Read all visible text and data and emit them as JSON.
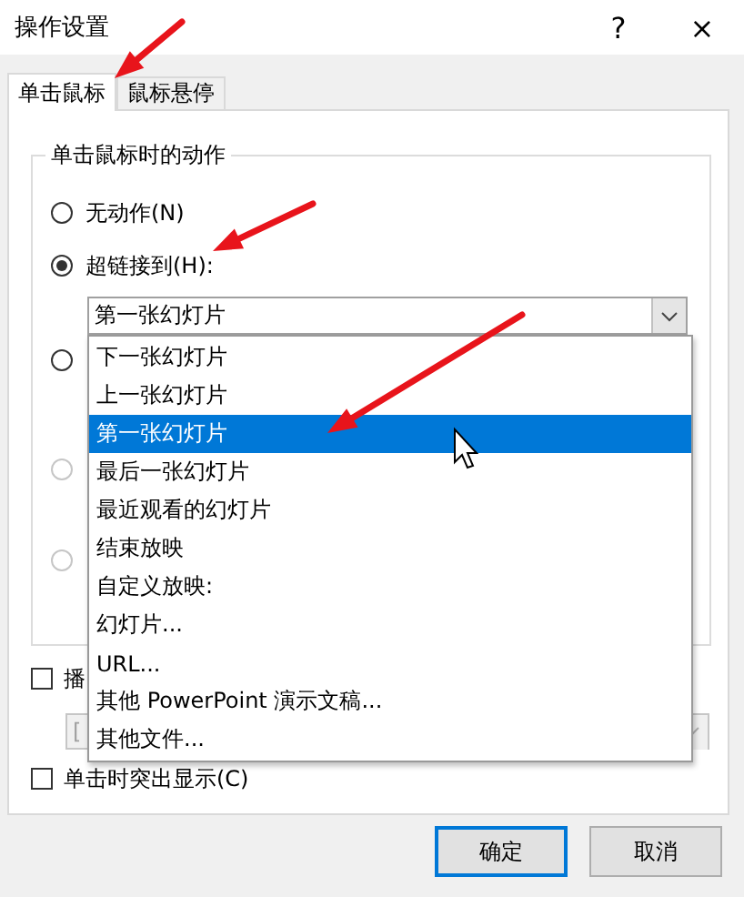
{
  "window": {
    "title": "操作设置",
    "help": "?",
    "close": "×"
  },
  "tabs": [
    {
      "label": "单击鼠标",
      "selected": true
    },
    {
      "label": "鼠标悬停",
      "selected": false
    }
  ],
  "group": {
    "legend": "单击鼠标时的动作",
    "radios": [
      {
        "label": "无动作(N)",
        "selected": false,
        "disabled": false
      },
      {
        "label": "超链接到(H):",
        "selected": true,
        "disabled": false
      },
      {
        "selected": false,
        "disabled": false
      },
      {
        "selected": false,
        "disabled": true
      },
      {
        "selected": false,
        "disabled": true
      }
    ],
    "link_combo": {
      "value": "第一张幻灯片",
      "expanded": true,
      "options": [
        {
          "label": "下一张幻灯片",
          "selected": false
        },
        {
          "label": "上一张幻灯片",
          "selected": false
        },
        {
          "label": "第一张幻灯片",
          "selected": true
        },
        {
          "label": "最后一张幻灯片",
          "selected": false
        },
        {
          "label": "最近观看的幻灯片",
          "selected": false
        },
        {
          "label": "结束放映",
          "selected": false
        },
        {
          "label": "自定义放映:",
          "selected": false
        },
        {
          "label": "幻灯片...",
          "selected": false
        },
        {
          "label": "URL...",
          "selected": false
        },
        {
          "label": "其他 PowerPoint 演示文稿...",
          "selected": false
        },
        {
          "label": "其他文件...",
          "selected": false
        }
      ]
    }
  },
  "sound": {
    "label": "播",
    "checked": false,
    "combo_value": "[",
    "disabled": true
  },
  "highlight": {
    "label": "单击时突出显示(C)",
    "checked": false
  },
  "buttons": [
    {
      "label": "确定",
      "default": true
    },
    {
      "label": "取消",
      "default": false
    }
  ]
}
